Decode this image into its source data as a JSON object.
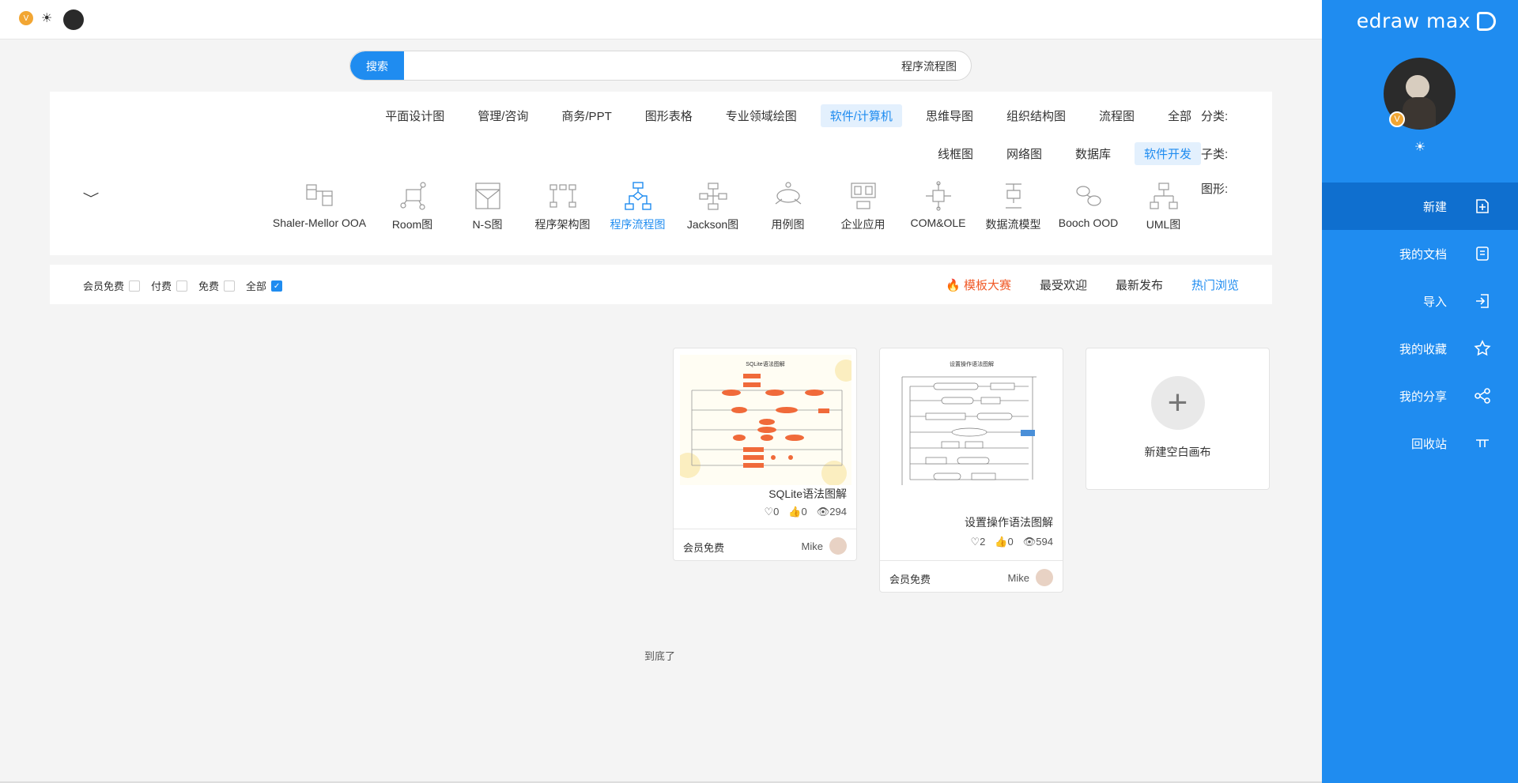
{
  "brand": {
    "name": "edraw max"
  },
  "sidebar": {
    "items": [
      {
        "label": "新建",
        "icon": "new-file-icon",
        "active": true
      },
      {
        "label": "我的文档",
        "icon": "document-icon"
      },
      {
        "label": "导入",
        "icon": "import-icon"
      },
      {
        "label": "我的收藏",
        "icon": "star-icon"
      },
      {
        "label": "我的分享",
        "icon": "share-icon"
      },
      {
        "label": "回收站",
        "icon": "trash-icon"
      }
    ],
    "theme_icon": "☀",
    "vip_badge": "V"
  },
  "topbar": {
    "vip_badge": "V",
    "theme_icon": "☀"
  },
  "search": {
    "button_label": "搜索",
    "value": "程序流程图"
  },
  "filters": {
    "category_label": "分类:",
    "categories": [
      "全部",
      "流程图",
      "组织结构图",
      "思维导图",
      "软件/计算机",
      "专业领域绘图",
      "图形表格",
      "商务/PPT",
      "管理/咨询",
      "平面设计图"
    ],
    "category_selected": 4,
    "sub_label": "子类:",
    "subcategories": [
      "软件开发",
      "数据库",
      "网络图",
      "线框图"
    ],
    "sub_selected": 0,
    "shape_label": "图形:",
    "shapes": [
      "UML图",
      "Booch OOD",
      "数据流模型",
      "COM&OLE",
      "企业应用",
      "用例图",
      "Jackson图",
      "程序流程图",
      "程序架构图",
      "N-S图",
      "Room图",
      "Shaler-Mellor OOA"
    ],
    "shape_selected": 7
  },
  "sortbar": {
    "tabs": [
      "热门浏览",
      "最新发布",
      "最受欢迎",
      "模板大赛"
    ],
    "selected": 0,
    "price_options": [
      "全部",
      "免费",
      "付费",
      "会员免费"
    ],
    "price_selected": 0
  },
  "cards": {
    "new_label": "新建空白画布",
    "templates": [
      {
        "title": "设置操作语法图解",
        "views": "594",
        "likes": "0",
        "favorites": "2",
        "author": "Mike",
        "price": "会员免费",
        "thumb_title": "设置操作语法图解"
      },
      {
        "title": "SQLite语法图解",
        "views": "294",
        "likes": "0",
        "favorites": "0",
        "author": "Mike",
        "price": "会员免费",
        "thumb_title": "SQLite语法图解"
      }
    ]
  },
  "footer": {
    "end_text": "到底了"
  },
  "colors": {
    "accent": "#1f8cf0",
    "accent_dark": "#0f6fcf",
    "contest": "#f05a28",
    "vip": "#f2a633"
  }
}
